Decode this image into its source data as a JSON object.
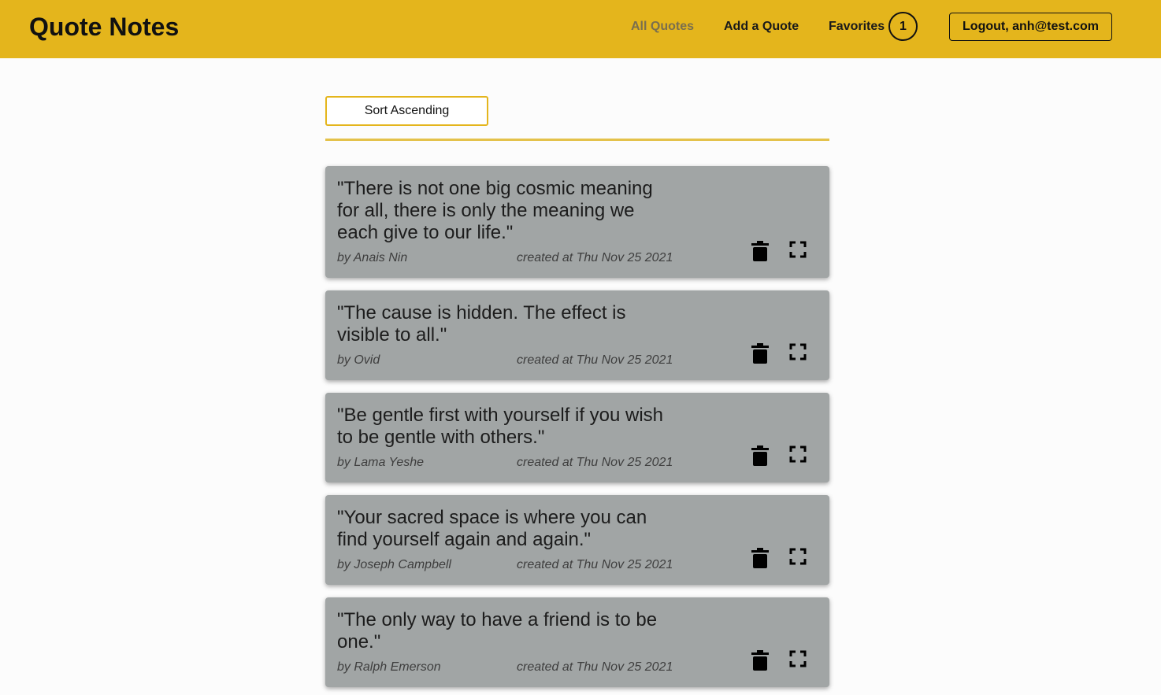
{
  "app": {
    "title": "Quote Notes"
  },
  "nav": {
    "all_quotes": "All Quotes",
    "add_quote": "Add a Quote",
    "favorites": "Favorites",
    "favorites_count": "1",
    "logout": "Logout, anh@test.com"
  },
  "toolbar": {
    "sort_label": "Sort Ascending"
  },
  "quotes": [
    {
      "text": "\"There is not one big cosmic meaning for all, there is only the meaning we each give to our life.\"",
      "author": "by Anais Nin",
      "created": "created at Thu Nov 25 2021"
    },
    {
      "text": "\"The cause is hidden. The effect is visible to all.\"",
      "author": "by Ovid",
      "created": "created at Thu Nov 25 2021"
    },
    {
      "text": "\"Be gentle first with yourself if you wish to be gentle with others.\"",
      "author": "by Lama Yeshe",
      "created": "created at Thu Nov 25 2021"
    },
    {
      "text": "\"Your sacred space is where you can find yourself again and again.\"",
      "author": "by Joseph Campbell",
      "created": "created at Thu Nov 25 2021"
    },
    {
      "text": "\"The only way to have a friend is to be one.\"",
      "author": "by Ralph Emerson",
      "created": "created at Thu Nov 25 2021"
    }
  ],
  "colors": {
    "header": "#e4b51c",
    "card": "#a1a5a5",
    "accent": "#e4b51c"
  },
  "icons": {
    "delete": "trash-icon",
    "expand": "fullscreen-icon"
  }
}
